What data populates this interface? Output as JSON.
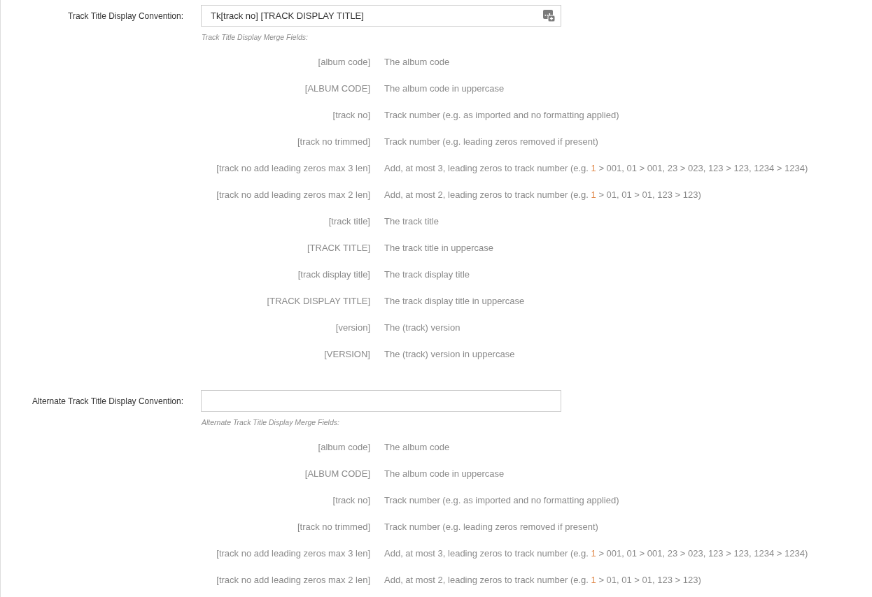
{
  "fields": [
    {
      "label": "Track Title Display Convention:",
      "value": "Tk[track no] [TRACK DISPLAY TITLE]",
      "merge_icon": true,
      "merge_fields_title": "Track Title Display Merge Fields:",
      "merge_fields": [
        {
          "code": "[album code]",
          "description": [
            {
              "kind": "text",
              "text": "The album code"
            }
          ]
        },
        {
          "code": "[ALBUM CODE]",
          "description": [
            {
              "kind": "text",
              "text": "The album code in uppercase"
            }
          ]
        },
        {
          "code": "[track no]",
          "description": [
            {
              "kind": "text",
              "text": "Track number (e.g. as imported and no formatting applied)"
            }
          ]
        },
        {
          "code": "[track no trimmed]",
          "description": [
            {
              "kind": "text",
              "text": "Track number (e.g. leading zeros removed if present)"
            }
          ]
        },
        {
          "code": "[track no add leading zeros max 3 len]",
          "description": [
            {
              "kind": "text",
              "text": "Add, at most 3, leading zeros to track number (e.g. "
            },
            {
              "kind": "highlight",
              "text": "1"
            },
            {
              "kind": "text",
              "text": " > 001, 01 > 001, 23 > 023, 123 > 123, 1234 > 1234)"
            }
          ]
        },
        {
          "code": "[track no add leading zeros max 2 len]",
          "description": [
            {
              "kind": "text",
              "text": "Add, at most 2, leading zeros to track number (e.g. "
            },
            {
              "kind": "highlight",
              "text": "1"
            },
            {
              "kind": "text",
              "text": " > 01, 01 > 01, 123 > 123)"
            }
          ]
        },
        {
          "code": "[track title]",
          "description": [
            {
              "kind": "text",
              "text": "The track title"
            }
          ]
        },
        {
          "code": "[TRACK TITLE]",
          "description": [
            {
              "kind": "text",
              "text": "The track title in uppercase"
            }
          ]
        },
        {
          "code": "[track display title]",
          "description": [
            {
              "kind": "text",
              "text": "The track display title"
            }
          ]
        },
        {
          "code": "[TRACK DISPLAY TITLE]",
          "description": [
            {
              "kind": "text",
              "text": "The track display title in uppercase"
            }
          ]
        },
        {
          "code": "[version]",
          "description": [
            {
              "kind": "text",
              "text": "The (track) version"
            }
          ]
        },
        {
          "code": "[VERSION]",
          "description": [
            {
              "kind": "text",
              "text": "The (track) version in uppercase"
            }
          ]
        }
      ]
    },
    {
      "label": "Alternate Track Title Display Convention:",
      "merge_icon": false,
      "merge_fields_title": "Alternate Track Title Display Merge Fields:",
      "merge_fields": [
        {
          "code": "[album code]",
          "description": [
            {
              "kind": "text",
              "text": "The album code"
            }
          ]
        },
        {
          "code": "[ALBUM CODE]",
          "description": [
            {
              "kind": "text",
              "text": "The album code in uppercase"
            }
          ]
        },
        {
          "code": "[track no]",
          "description": [
            {
              "kind": "text",
              "text": "Track number (e.g. as imported and no formatting applied)"
            }
          ]
        },
        {
          "code": "[track no trimmed]",
          "description": [
            {
              "kind": "text",
              "text": "Track number (e.g. leading zeros removed if present)"
            }
          ]
        },
        {
          "code": "[track no add leading zeros max 3 len]",
          "description": [
            {
              "kind": "text",
              "text": "Add, at most 3, leading zeros to track number (e.g. "
            },
            {
              "kind": "highlight",
              "text": "1"
            },
            {
              "kind": "text",
              "text": " > 001, 01 > 001, 23 > 023, 123 > 123, 1234 > 1234)"
            }
          ]
        },
        {
          "code": "[track no add leading zeros max 2 len]",
          "description": [
            {
              "kind": "text",
              "text": "Add, at most 2, leading zeros to track number (e.g. "
            },
            {
              "kind": "highlight",
              "text": "1"
            },
            {
              "kind": "text",
              "text": " > 01, 01 > 01, 123 > 123)"
            }
          ]
        }
      ]
    }
  ]
}
